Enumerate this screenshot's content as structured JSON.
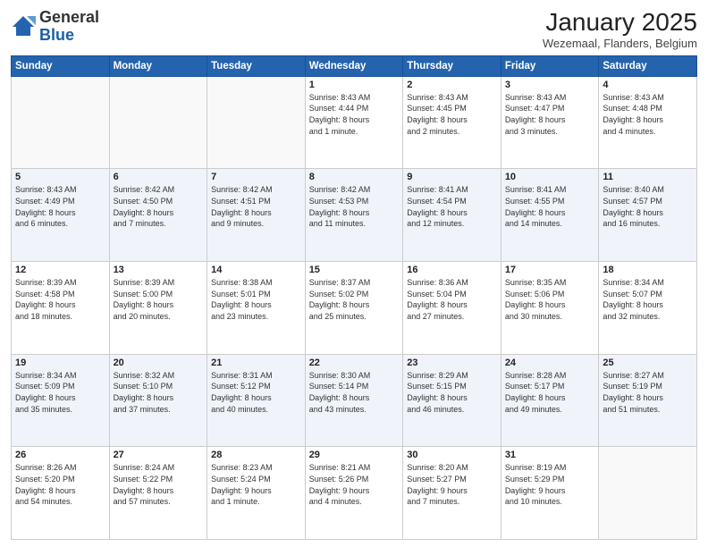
{
  "header": {
    "logo_general": "General",
    "logo_blue": "Blue",
    "month": "January 2025",
    "location": "Wezemaal, Flanders, Belgium"
  },
  "weekdays": [
    "Sunday",
    "Monday",
    "Tuesday",
    "Wednesday",
    "Thursday",
    "Friday",
    "Saturday"
  ],
  "weeks": [
    [
      {
        "num": "",
        "info": ""
      },
      {
        "num": "",
        "info": ""
      },
      {
        "num": "",
        "info": ""
      },
      {
        "num": "1",
        "info": "Sunrise: 8:43 AM\nSunset: 4:44 PM\nDaylight: 8 hours\nand 1 minute."
      },
      {
        "num": "2",
        "info": "Sunrise: 8:43 AM\nSunset: 4:45 PM\nDaylight: 8 hours\nand 2 minutes."
      },
      {
        "num": "3",
        "info": "Sunrise: 8:43 AM\nSunset: 4:47 PM\nDaylight: 8 hours\nand 3 minutes."
      },
      {
        "num": "4",
        "info": "Sunrise: 8:43 AM\nSunset: 4:48 PM\nDaylight: 8 hours\nand 4 minutes."
      }
    ],
    [
      {
        "num": "5",
        "info": "Sunrise: 8:43 AM\nSunset: 4:49 PM\nDaylight: 8 hours\nand 6 minutes."
      },
      {
        "num": "6",
        "info": "Sunrise: 8:42 AM\nSunset: 4:50 PM\nDaylight: 8 hours\nand 7 minutes."
      },
      {
        "num": "7",
        "info": "Sunrise: 8:42 AM\nSunset: 4:51 PM\nDaylight: 8 hours\nand 9 minutes."
      },
      {
        "num": "8",
        "info": "Sunrise: 8:42 AM\nSunset: 4:53 PM\nDaylight: 8 hours\nand 11 minutes."
      },
      {
        "num": "9",
        "info": "Sunrise: 8:41 AM\nSunset: 4:54 PM\nDaylight: 8 hours\nand 12 minutes."
      },
      {
        "num": "10",
        "info": "Sunrise: 8:41 AM\nSunset: 4:55 PM\nDaylight: 8 hours\nand 14 minutes."
      },
      {
        "num": "11",
        "info": "Sunrise: 8:40 AM\nSunset: 4:57 PM\nDaylight: 8 hours\nand 16 minutes."
      }
    ],
    [
      {
        "num": "12",
        "info": "Sunrise: 8:39 AM\nSunset: 4:58 PM\nDaylight: 8 hours\nand 18 minutes."
      },
      {
        "num": "13",
        "info": "Sunrise: 8:39 AM\nSunset: 5:00 PM\nDaylight: 8 hours\nand 20 minutes."
      },
      {
        "num": "14",
        "info": "Sunrise: 8:38 AM\nSunset: 5:01 PM\nDaylight: 8 hours\nand 23 minutes."
      },
      {
        "num": "15",
        "info": "Sunrise: 8:37 AM\nSunset: 5:02 PM\nDaylight: 8 hours\nand 25 minutes."
      },
      {
        "num": "16",
        "info": "Sunrise: 8:36 AM\nSunset: 5:04 PM\nDaylight: 8 hours\nand 27 minutes."
      },
      {
        "num": "17",
        "info": "Sunrise: 8:35 AM\nSunset: 5:06 PM\nDaylight: 8 hours\nand 30 minutes."
      },
      {
        "num": "18",
        "info": "Sunrise: 8:34 AM\nSunset: 5:07 PM\nDaylight: 8 hours\nand 32 minutes."
      }
    ],
    [
      {
        "num": "19",
        "info": "Sunrise: 8:34 AM\nSunset: 5:09 PM\nDaylight: 8 hours\nand 35 minutes."
      },
      {
        "num": "20",
        "info": "Sunrise: 8:32 AM\nSunset: 5:10 PM\nDaylight: 8 hours\nand 37 minutes."
      },
      {
        "num": "21",
        "info": "Sunrise: 8:31 AM\nSunset: 5:12 PM\nDaylight: 8 hours\nand 40 minutes."
      },
      {
        "num": "22",
        "info": "Sunrise: 8:30 AM\nSunset: 5:14 PM\nDaylight: 8 hours\nand 43 minutes."
      },
      {
        "num": "23",
        "info": "Sunrise: 8:29 AM\nSunset: 5:15 PM\nDaylight: 8 hours\nand 46 minutes."
      },
      {
        "num": "24",
        "info": "Sunrise: 8:28 AM\nSunset: 5:17 PM\nDaylight: 8 hours\nand 49 minutes."
      },
      {
        "num": "25",
        "info": "Sunrise: 8:27 AM\nSunset: 5:19 PM\nDaylight: 8 hours\nand 51 minutes."
      }
    ],
    [
      {
        "num": "26",
        "info": "Sunrise: 8:26 AM\nSunset: 5:20 PM\nDaylight: 8 hours\nand 54 minutes."
      },
      {
        "num": "27",
        "info": "Sunrise: 8:24 AM\nSunset: 5:22 PM\nDaylight: 8 hours\nand 57 minutes."
      },
      {
        "num": "28",
        "info": "Sunrise: 8:23 AM\nSunset: 5:24 PM\nDaylight: 9 hours\nand 1 minute."
      },
      {
        "num": "29",
        "info": "Sunrise: 8:21 AM\nSunset: 5:26 PM\nDaylight: 9 hours\nand 4 minutes."
      },
      {
        "num": "30",
        "info": "Sunrise: 8:20 AM\nSunset: 5:27 PM\nDaylight: 9 hours\nand 7 minutes."
      },
      {
        "num": "31",
        "info": "Sunrise: 8:19 AM\nSunset: 5:29 PM\nDaylight: 9 hours\nand 10 minutes."
      },
      {
        "num": "",
        "info": ""
      }
    ]
  ]
}
